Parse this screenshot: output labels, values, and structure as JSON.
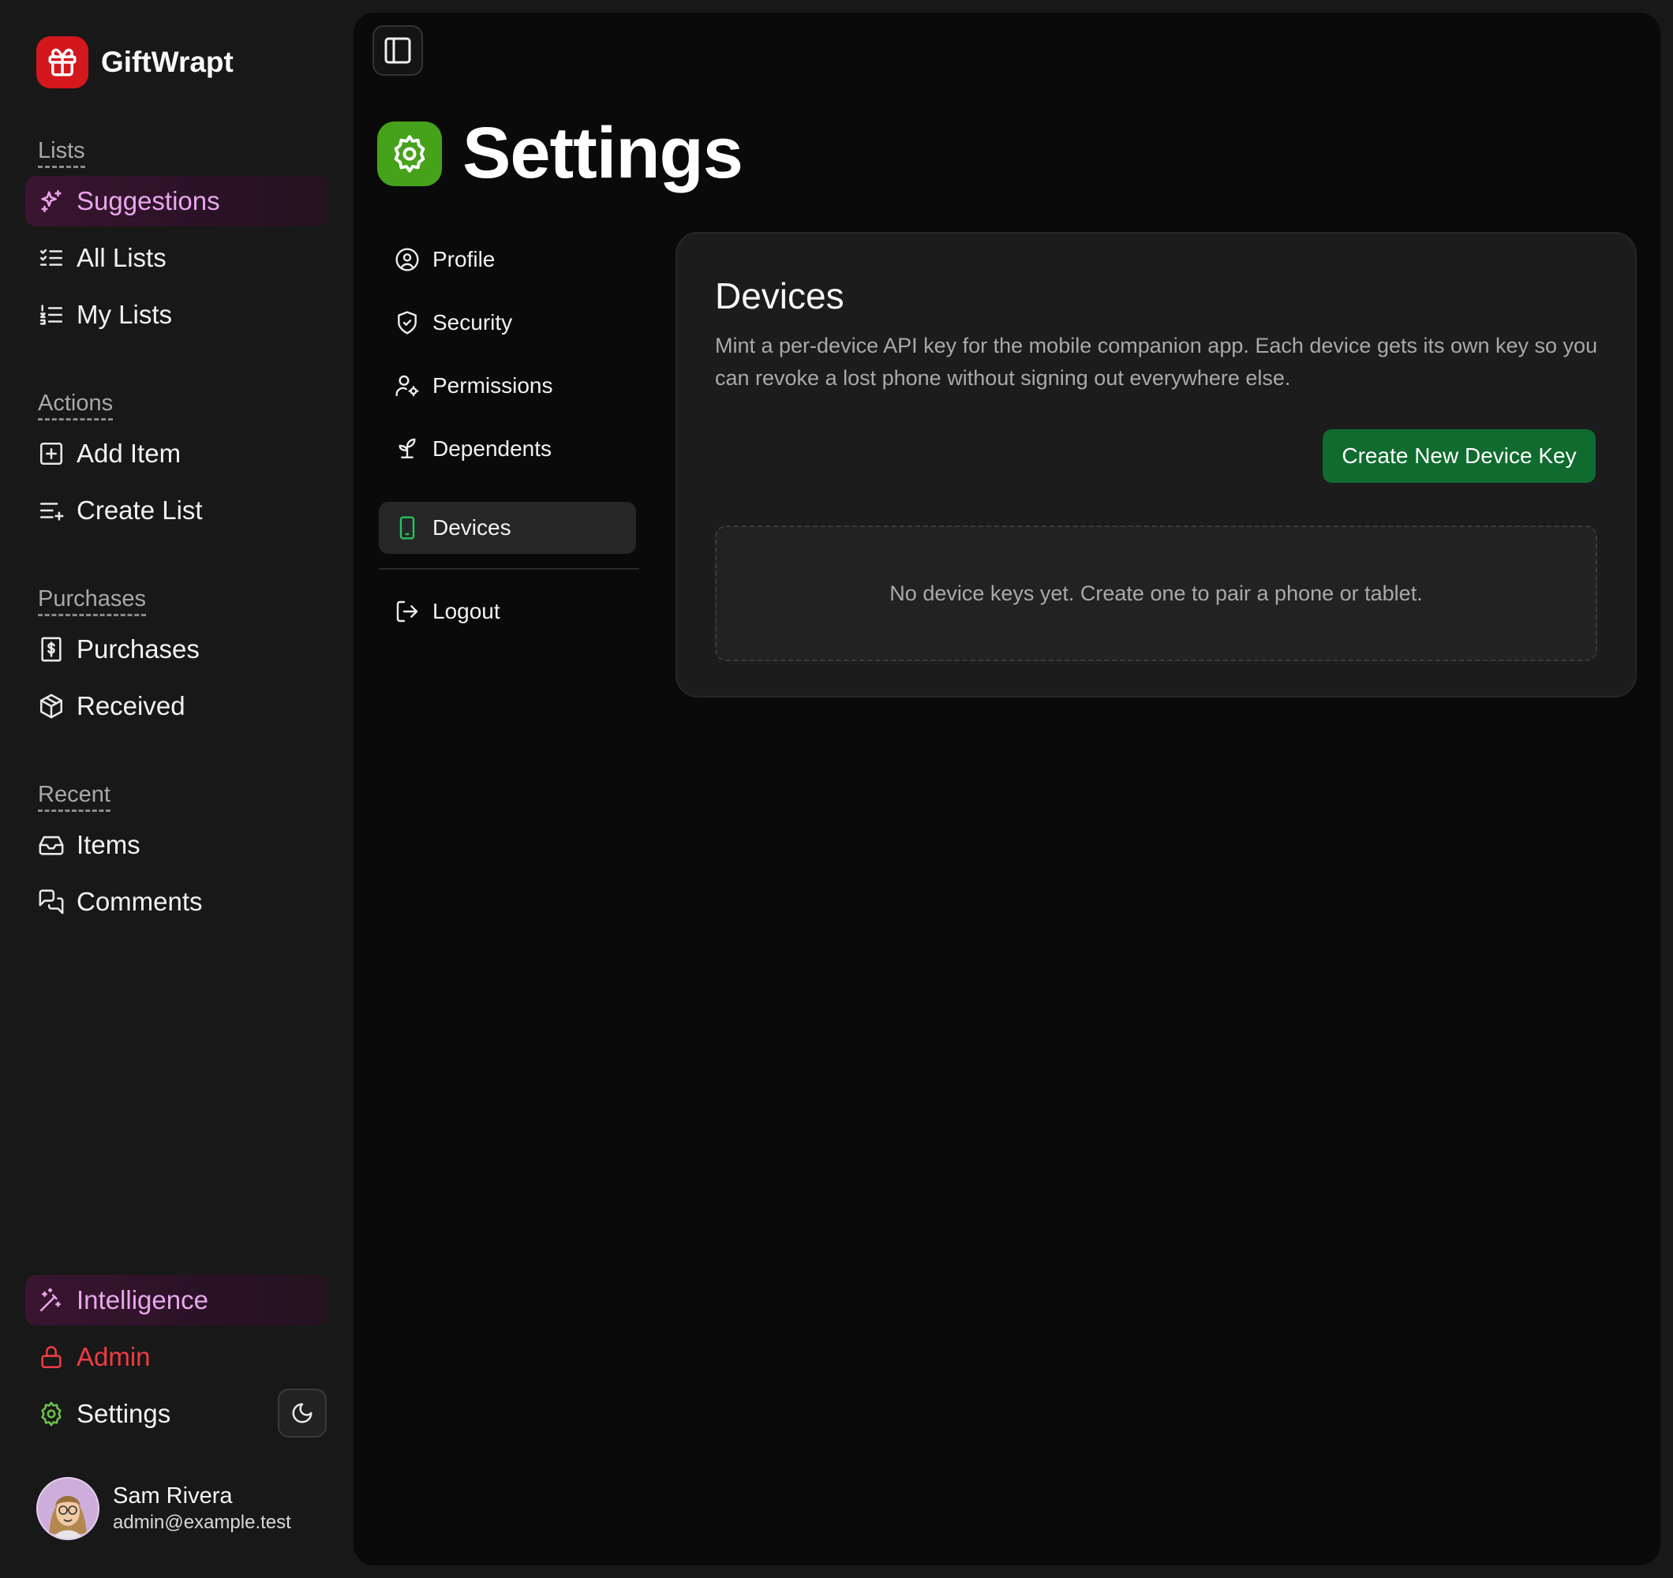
{
  "brand": {
    "name": "GiftWrapt",
    "logo_icon": "gift-icon",
    "logo_color": "#d4161d"
  },
  "sidebar": {
    "sections": {
      "lists": "Lists",
      "actions": "Actions",
      "purchases": "Purchases",
      "recent": "Recent"
    },
    "items": {
      "suggestions": "Suggestions",
      "all_lists": "All Lists",
      "my_lists": "My Lists",
      "add_item": "Add Item",
      "create_list": "Create List",
      "purchases": "Purchases",
      "received": "Received",
      "items": "Items",
      "comments": "Comments",
      "intelligence": "Intelligence",
      "admin": "Admin",
      "settings": "Settings"
    },
    "highlight_color": "#e9a6ec",
    "admin_color": "#ef3b43"
  },
  "user": {
    "name": "Sam Rivera",
    "email": "admin@example.test"
  },
  "page": {
    "title": "Settings",
    "icon": "gear-icon",
    "icon_color": "#46a21b"
  },
  "settings_nav": {
    "profile": "Profile",
    "security": "Security",
    "permissions": "Permissions",
    "dependents": "Dependents",
    "devices": "Devices",
    "logout": "Logout",
    "active": "Devices"
  },
  "devices": {
    "title": "Devices",
    "description": "Mint a per-device API key for the mobile companion app. Each device gets its own key so you can revoke a lost phone without signing out everywhere else.",
    "create_button": "Create New Device Key",
    "empty_message": "No device keys yet. Create one to pair a phone or tablet.",
    "button_color": "#0f6b2e"
  }
}
